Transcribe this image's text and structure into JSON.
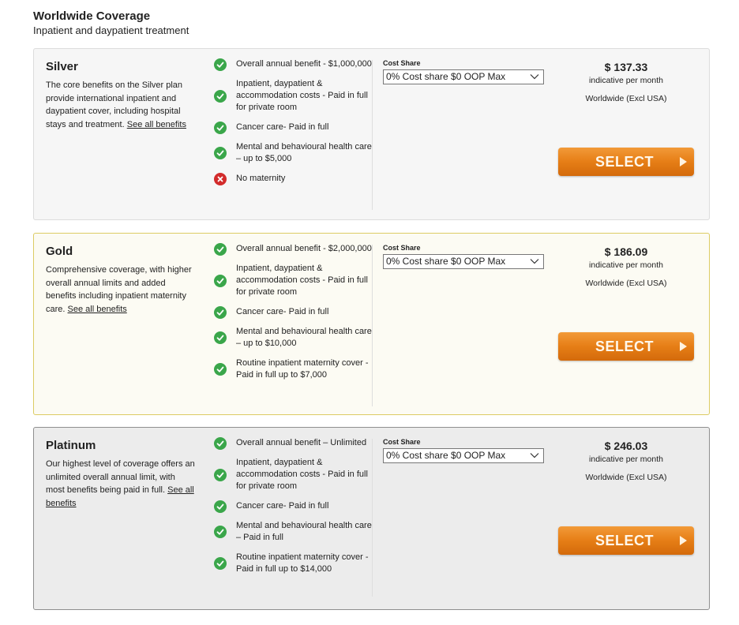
{
  "header": {
    "title": "Worldwide Coverage",
    "subtitle": "Inpatient and daypatient treatment"
  },
  "colors": {
    "check_green": "#3aa64a",
    "cross_red": "#d22b2b",
    "button_orange": "#e67e16"
  },
  "plans": [
    {
      "name": "Silver",
      "description": "The core benefits on the Silver plan provide international inpatient and daypatient cover, including hospital stays and treatment.",
      "link": "See all benefits",
      "benefits": [
        {
          "icon": "check-icon",
          "text": "Overall annual benefit - $1,000,000"
        },
        {
          "icon": "check-icon",
          "text": "Inpatient, daypatient & accommodation costs - Paid in full for private room"
        },
        {
          "icon": "check-icon",
          "text": "Cancer care- Paid in full"
        },
        {
          "icon": "check-icon",
          "text": "Mental and behavioural health care – up to $5,000"
        },
        {
          "icon": "cross-icon",
          "text": "No maternity"
        }
      ],
      "cost_share_label": "Cost Share",
      "cost_share_value": "0% Cost share $0 OOP Max",
      "price": "$ 137.33",
      "price_note": "indicative per month",
      "region": "Worldwide (Excl USA)",
      "select_label": "SELECT"
    },
    {
      "name": "Gold",
      "description": "Comprehensive coverage, with higher overall annual limits and added benefits including inpatient maternity care.",
      "link": "See all benefits",
      "benefits": [
        {
          "icon": "check-icon",
          "text": "Overall annual benefit - $2,000,000"
        },
        {
          "icon": "check-icon",
          "text": "Inpatient, daypatient & accommodation costs - Paid in full for private room"
        },
        {
          "icon": "check-icon",
          "text": "Cancer care- Paid in full"
        },
        {
          "icon": "check-icon",
          "text": "Mental and behavioural health care – up to $10,000"
        },
        {
          "icon": "check-icon",
          "text": "Routine inpatient maternity cover - Paid in full up to $7,000"
        }
      ],
      "cost_share_label": "Cost Share",
      "cost_share_value": "0% Cost share $0 OOP Max",
      "price": "$ 186.09",
      "price_note": "indicative per month",
      "region": "Worldwide (Excl USA)",
      "select_label": "SELECT"
    },
    {
      "name": "Platinum",
      "description": "Our highest level of coverage offers an unlimited overall annual limit, with most benefits being paid in full.",
      "link": "See all benefits",
      "benefits": [
        {
          "icon": "check-icon",
          "text": "Overall annual benefit – Unlimited"
        },
        {
          "icon": "check-icon",
          "text": "Inpatient, daypatient & accommodation costs - Paid in full for private room"
        },
        {
          "icon": "check-icon",
          "text": "Cancer care- Paid in full"
        },
        {
          "icon": "check-icon",
          "text": "Mental and behavioural health care – Paid in full"
        },
        {
          "icon": "check-icon",
          "text": "Routine inpatient maternity cover - Paid in full up to $14,000"
        }
      ],
      "cost_share_label": "Cost Share",
      "cost_share_value": "0% Cost share $0 OOP Max",
      "price": "$ 246.03",
      "price_note": "indicative per month",
      "region": "Worldwide (Excl USA)",
      "select_label": "SELECT"
    }
  ]
}
